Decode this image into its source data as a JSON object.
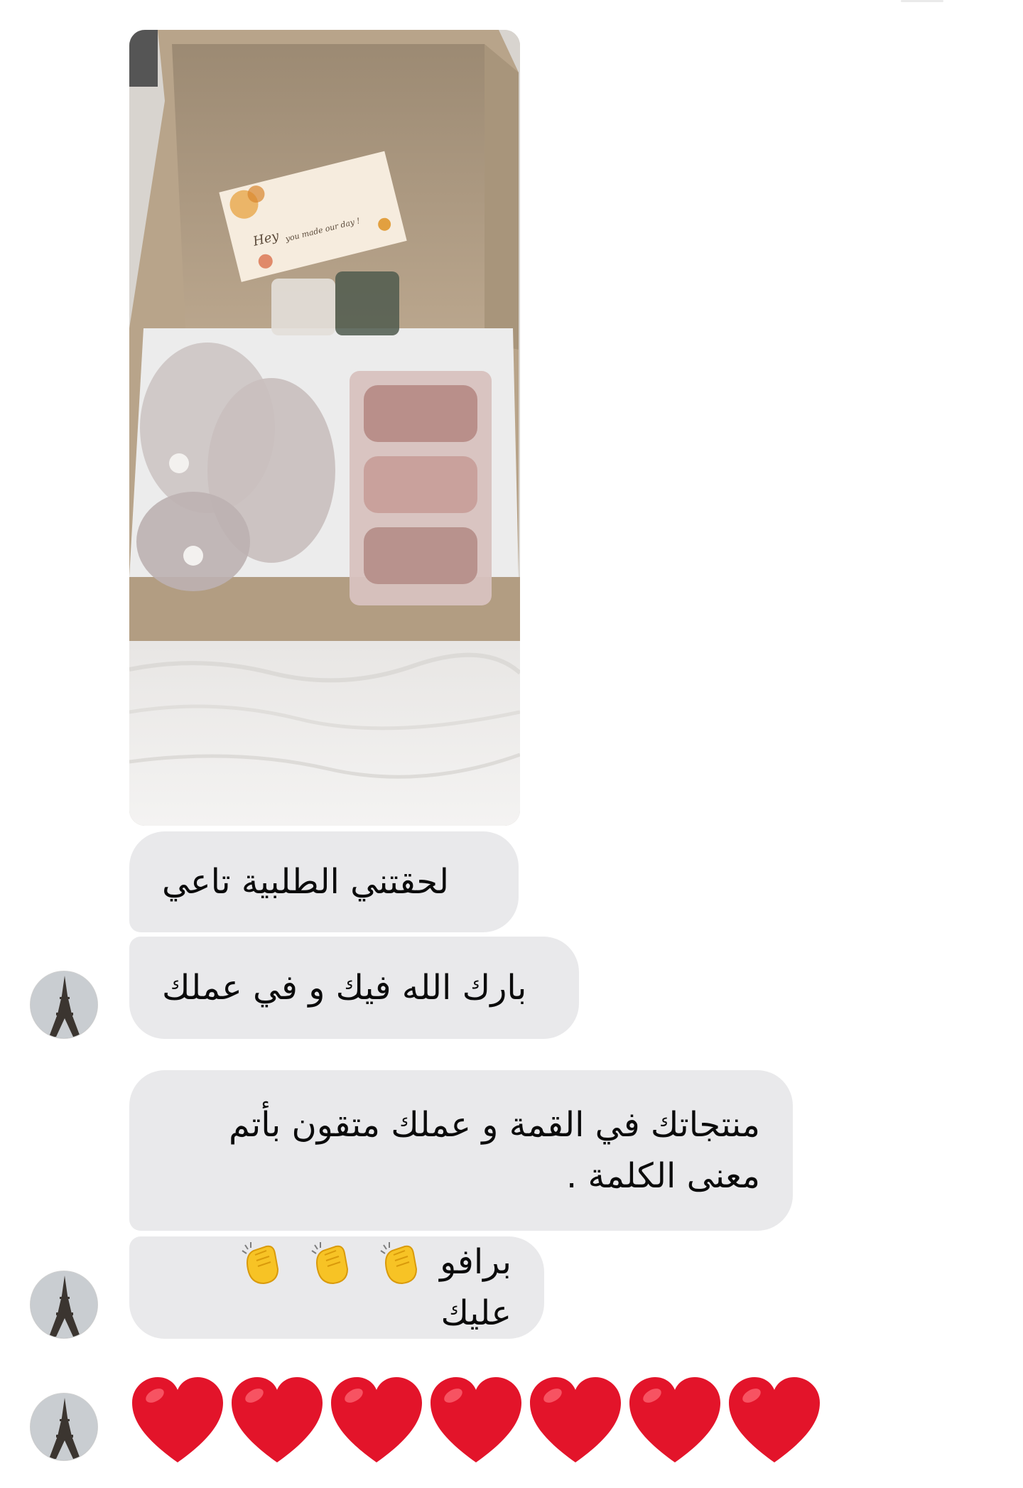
{
  "conversation": {
    "messages": [
      {
        "id": "m1",
        "type": "image",
        "sender": "contact",
        "content": "photo-gift-box"
      },
      {
        "id": "m2",
        "type": "text",
        "sender": "contact",
        "text": "لحقتني  الطلبية تاعي"
      },
      {
        "id": "m3",
        "type": "text",
        "sender": "contact",
        "text": "بارك الله فيك و في عملك"
      },
      {
        "id": "m4",
        "type": "text",
        "sender": "contact",
        "lines": [
          "منتجاتك  في القمة و عملك  متقون بأتم",
          "معنى الكلمة ."
        ]
      },
      {
        "id": "m5",
        "type": "text",
        "sender": "contact",
        "text_before": "برافو",
        "emoji": [
          "clapping-hands",
          "clapping-hands",
          "clapping-hands"
        ],
        "text_after": "عليك"
      },
      {
        "id": "m6",
        "type": "emoji",
        "sender": "contact",
        "emoji": [
          "red-heart",
          "red-heart",
          "red-heart",
          "red-heart",
          "red-heart",
          "red-heart",
          "red-heart"
        ]
      }
    ],
    "photo": {
      "card_text_1": "Hey",
      "card_text_2": "you made our day !"
    },
    "avatar_icon": "eiffel-tower-avatar",
    "colors": {
      "bubble": "#e9e9eb",
      "text": "#0b0b0b",
      "heart": "#e3142a",
      "clap": "#f7c325"
    }
  }
}
